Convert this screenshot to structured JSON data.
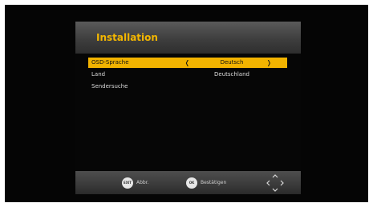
{
  "title": "Installation",
  "menu": {
    "items": [
      {
        "label": "OSD-Sprache",
        "value": "Deutsch",
        "selected": true
      },
      {
        "label": "Land",
        "value": "Deutschland",
        "selected": false
      },
      {
        "label": "Sendersuche",
        "value": "",
        "selected": false
      }
    ],
    "arrow_left": "❬",
    "arrow_right": "❭"
  },
  "footer": {
    "exit_key": "EXIT",
    "exit_label": "Abbr.",
    "ok_key": "OK",
    "ok_label": "Bestätigen",
    "nav_icon": "navigation-arrows-icon"
  },
  "colors": {
    "highlight": "#f2b300",
    "title": "#f3b600",
    "background": "#050505"
  }
}
